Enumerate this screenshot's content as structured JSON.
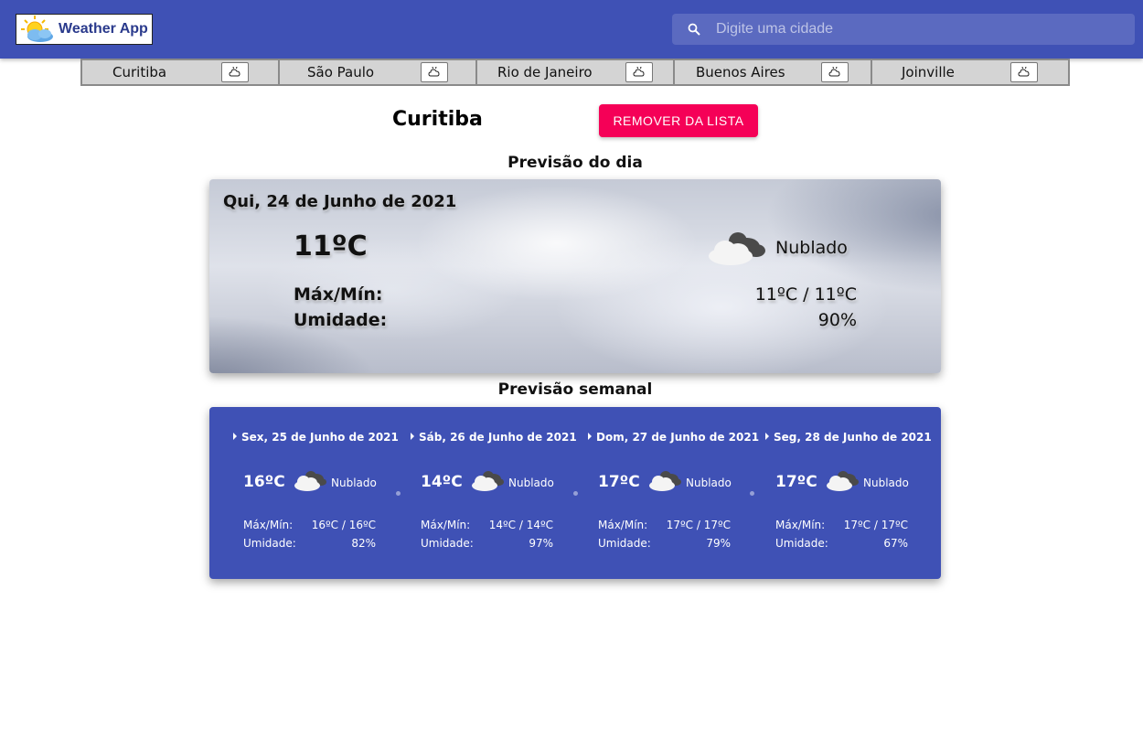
{
  "app": {
    "title": "Weather App",
    "logo_icon": "sun-cloud-icon",
    "colors": {
      "appbar": "#3f51b5",
      "accent": "#f50057",
      "week_card": "#3f51b5"
    }
  },
  "search": {
    "placeholder": "Digite uma cidade",
    "value": "",
    "icon": "search-icon"
  },
  "cities": [
    {
      "name": "Curitiba",
      "icon": "weather-icon"
    },
    {
      "name": "São Paulo",
      "icon": "weather-icon"
    },
    {
      "name": "Rio de Janeiro",
      "icon": "weather-icon"
    },
    {
      "name": "Buenos Aires",
      "icon": "weather-icon"
    },
    {
      "name": "Joinville",
      "icon": "weather-icon"
    }
  ],
  "selected_city": "Curitiba",
  "remove_button": "REMOVER DA LISTA",
  "today": {
    "section_title": "Previsão do dia",
    "date": "Qui, 24 de Junho de 2021",
    "temp": "11ºC",
    "condition": "Nublado",
    "condition_icon": "cloudy-icon",
    "maxmin_label": "Máx/Mín:",
    "maxmin_value": "11ºC / 11ºC",
    "humidity_label": "Umidade:",
    "humidity_value": "90%"
  },
  "week": {
    "section_title": "Previsão semanal",
    "days": [
      {
        "date": "Sex, 25 de Junho de 2021",
        "temp": "16ºC",
        "condition": "Nublado",
        "maxmin_label": "Máx/Mín:",
        "maxmin": "16ºC / 16ºC",
        "humidity_label": "Umidade:",
        "humidity": "82%"
      },
      {
        "date": "Sáb, 26 de Junho de 2021",
        "temp": "14ºC",
        "condition": "Nublado",
        "maxmin_label": "Máx/Mín:",
        "maxmin": "14ºC / 14ºC",
        "humidity_label": "Umidade:",
        "humidity": "97%"
      },
      {
        "date": "Dom, 27 de Junho de 2021",
        "temp": "17ºC",
        "condition": "Nublado",
        "maxmin_label": "Máx/Mín:",
        "maxmin": "17ºC / 17ºC",
        "humidity_label": "Umidade:",
        "humidity": "79%"
      },
      {
        "date": "Seg, 28 de Junho de 2021",
        "temp": "17ºC",
        "condition": "Nublado",
        "maxmin_label": "Máx/Mín:",
        "maxmin": "17ºC / 17ºC",
        "humidity_label": "Umidade:",
        "humidity": "67%"
      }
    ]
  }
}
